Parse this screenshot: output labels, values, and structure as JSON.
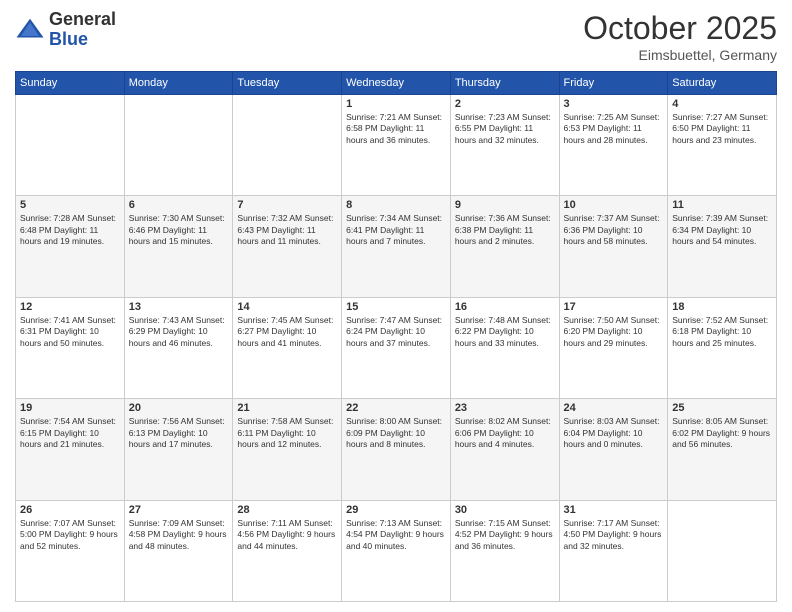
{
  "header": {
    "logo_general": "General",
    "logo_blue": "Blue",
    "month": "October 2025",
    "location": "Eimsbuettel, Germany"
  },
  "weekdays": [
    "Sunday",
    "Monday",
    "Tuesday",
    "Wednesday",
    "Thursday",
    "Friday",
    "Saturday"
  ],
  "weeks": [
    [
      {
        "day": "",
        "content": ""
      },
      {
        "day": "",
        "content": ""
      },
      {
        "day": "",
        "content": ""
      },
      {
        "day": "1",
        "content": "Sunrise: 7:21 AM\nSunset: 6:58 PM\nDaylight: 11 hours and 36 minutes."
      },
      {
        "day": "2",
        "content": "Sunrise: 7:23 AM\nSunset: 6:55 PM\nDaylight: 11 hours and 32 minutes."
      },
      {
        "day": "3",
        "content": "Sunrise: 7:25 AM\nSunset: 6:53 PM\nDaylight: 11 hours and 28 minutes."
      },
      {
        "day": "4",
        "content": "Sunrise: 7:27 AM\nSunset: 6:50 PM\nDaylight: 11 hours and 23 minutes."
      }
    ],
    [
      {
        "day": "5",
        "content": "Sunrise: 7:28 AM\nSunset: 6:48 PM\nDaylight: 11 hours and 19 minutes."
      },
      {
        "day": "6",
        "content": "Sunrise: 7:30 AM\nSunset: 6:46 PM\nDaylight: 11 hours and 15 minutes."
      },
      {
        "day": "7",
        "content": "Sunrise: 7:32 AM\nSunset: 6:43 PM\nDaylight: 11 hours and 11 minutes."
      },
      {
        "day": "8",
        "content": "Sunrise: 7:34 AM\nSunset: 6:41 PM\nDaylight: 11 hours and 7 minutes."
      },
      {
        "day": "9",
        "content": "Sunrise: 7:36 AM\nSunset: 6:38 PM\nDaylight: 11 hours and 2 minutes."
      },
      {
        "day": "10",
        "content": "Sunrise: 7:37 AM\nSunset: 6:36 PM\nDaylight: 10 hours and 58 minutes."
      },
      {
        "day": "11",
        "content": "Sunrise: 7:39 AM\nSunset: 6:34 PM\nDaylight: 10 hours and 54 minutes."
      }
    ],
    [
      {
        "day": "12",
        "content": "Sunrise: 7:41 AM\nSunset: 6:31 PM\nDaylight: 10 hours and 50 minutes."
      },
      {
        "day": "13",
        "content": "Sunrise: 7:43 AM\nSunset: 6:29 PM\nDaylight: 10 hours and 46 minutes."
      },
      {
        "day": "14",
        "content": "Sunrise: 7:45 AM\nSunset: 6:27 PM\nDaylight: 10 hours and 41 minutes."
      },
      {
        "day": "15",
        "content": "Sunrise: 7:47 AM\nSunset: 6:24 PM\nDaylight: 10 hours and 37 minutes."
      },
      {
        "day": "16",
        "content": "Sunrise: 7:48 AM\nSunset: 6:22 PM\nDaylight: 10 hours and 33 minutes."
      },
      {
        "day": "17",
        "content": "Sunrise: 7:50 AM\nSunset: 6:20 PM\nDaylight: 10 hours and 29 minutes."
      },
      {
        "day": "18",
        "content": "Sunrise: 7:52 AM\nSunset: 6:18 PM\nDaylight: 10 hours and 25 minutes."
      }
    ],
    [
      {
        "day": "19",
        "content": "Sunrise: 7:54 AM\nSunset: 6:15 PM\nDaylight: 10 hours and 21 minutes."
      },
      {
        "day": "20",
        "content": "Sunrise: 7:56 AM\nSunset: 6:13 PM\nDaylight: 10 hours and 17 minutes."
      },
      {
        "day": "21",
        "content": "Sunrise: 7:58 AM\nSunset: 6:11 PM\nDaylight: 10 hours and 12 minutes."
      },
      {
        "day": "22",
        "content": "Sunrise: 8:00 AM\nSunset: 6:09 PM\nDaylight: 10 hours and 8 minutes."
      },
      {
        "day": "23",
        "content": "Sunrise: 8:02 AM\nSunset: 6:06 PM\nDaylight: 10 hours and 4 minutes."
      },
      {
        "day": "24",
        "content": "Sunrise: 8:03 AM\nSunset: 6:04 PM\nDaylight: 10 hours and 0 minutes."
      },
      {
        "day": "25",
        "content": "Sunrise: 8:05 AM\nSunset: 6:02 PM\nDaylight: 9 hours and 56 minutes."
      }
    ],
    [
      {
        "day": "26",
        "content": "Sunrise: 7:07 AM\nSunset: 5:00 PM\nDaylight: 9 hours and 52 minutes."
      },
      {
        "day": "27",
        "content": "Sunrise: 7:09 AM\nSunset: 4:58 PM\nDaylight: 9 hours and 48 minutes."
      },
      {
        "day": "28",
        "content": "Sunrise: 7:11 AM\nSunset: 4:56 PM\nDaylight: 9 hours and 44 minutes."
      },
      {
        "day": "29",
        "content": "Sunrise: 7:13 AM\nSunset: 4:54 PM\nDaylight: 9 hours and 40 minutes."
      },
      {
        "day": "30",
        "content": "Sunrise: 7:15 AM\nSunset: 4:52 PM\nDaylight: 9 hours and 36 minutes."
      },
      {
        "day": "31",
        "content": "Sunrise: 7:17 AM\nSunset: 4:50 PM\nDaylight: 9 hours and 32 minutes."
      },
      {
        "day": "",
        "content": ""
      }
    ]
  ]
}
